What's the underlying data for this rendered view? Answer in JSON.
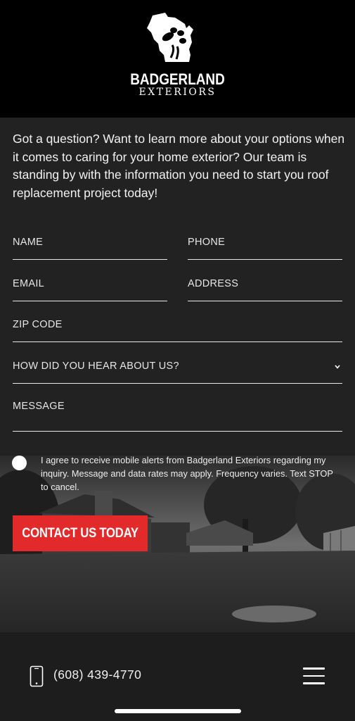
{
  "header": {
    "brand_title": "BADGERLAND",
    "brand_subtitle": "EXTERIORS"
  },
  "intro_text": "Got a question? Want to learn more about your options when it comes to caring for your home exterior? Our team is standing by with the information you need to start you roof replacement project today!",
  "form": {
    "name_placeholder": "NAME",
    "phone_placeholder": "PHONE",
    "email_placeholder": "EMAIL",
    "address_placeholder": "ADDRESS",
    "zip_placeholder": "ZIP CODE",
    "referral_placeholder": "HOW DID YOU HEAR ABOUT US?",
    "message_placeholder": "MESSAGE",
    "consent_text": "I agree to receive mobile alerts from Badgerland Exteriors regarding my inquiry. Message and data rates may apply. Frequency varies. Text STOP to cancel.",
    "submit_label": "CONTACT US TODAY"
  },
  "footer": {
    "phone_number": "(608) 439-4770"
  },
  "colors": {
    "accent": "#e22a2a",
    "header_bg": "#000000",
    "body_bg": "#222222"
  }
}
